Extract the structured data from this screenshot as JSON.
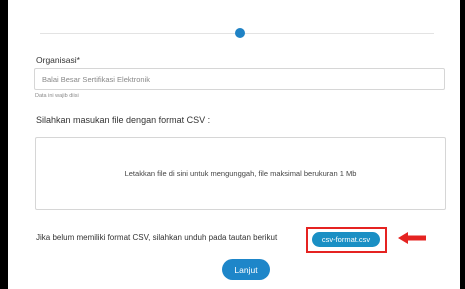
{
  "form": {
    "organisasi_label": "Organisasi*",
    "organisasi_value": "Balai Besar Sertifikasi Elektronik",
    "helper_text": "Data ini wajib diisi",
    "instruction": "Silahkan masukan file dengan format CSV :",
    "dropzone_text": "Letakkan file di sini untuk mengunggah, file maksimal berukuran 1 Mb",
    "csv_prompt": "Jika belum memiliki format CSV, silahkan unduh pada tautan berikut",
    "csv_link_label": "csv-format.csv",
    "next_button": "Lanjut"
  },
  "colors": {
    "accent": "#1e86c9",
    "highlight": "#e52321"
  },
  "icons": {
    "pointer": "arrow-left-icon"
  }
}
